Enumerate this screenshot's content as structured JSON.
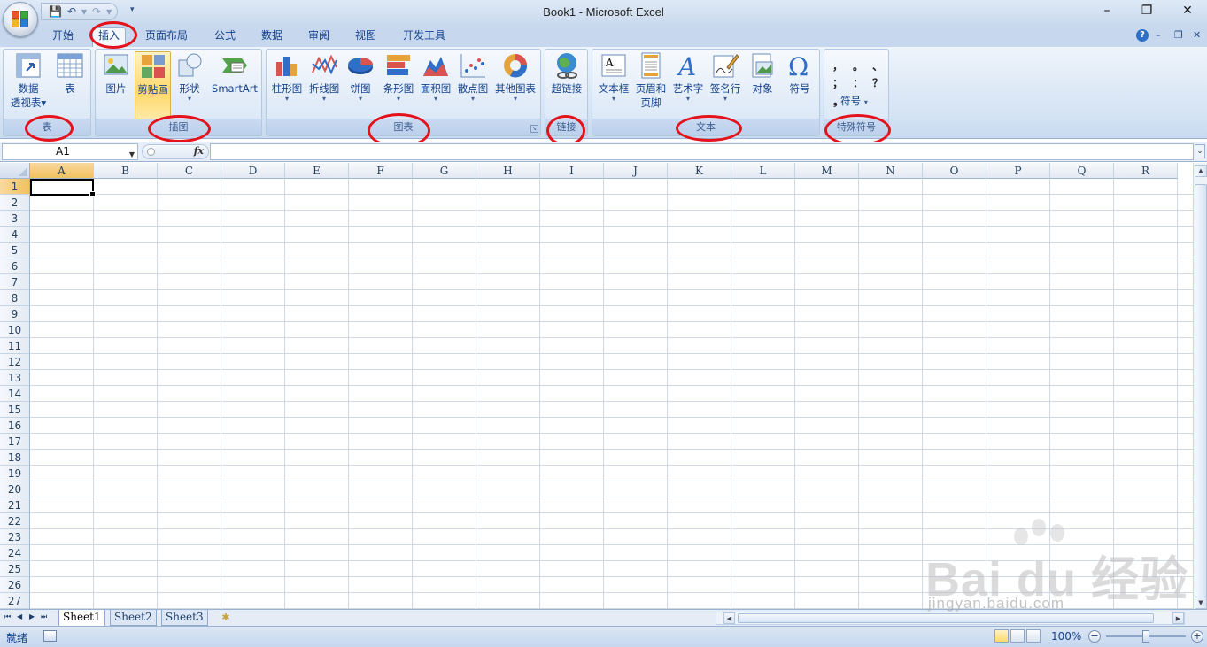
{
  "window": {
    "title": "Book1 - Microsoft Excel",
    "minimize": "–",
    "restore": "❐",
    "close": "✕"
  },
  "qat": {
    "save": "💾",
    "undo": "↶",
    "undo_dd": "▾",
    "redo": "↷",
    "redo_dd": "▾",
    "customize": "₹"
  },
  "tabs": [
    "开始",
    "插入",
    "页面布局",
    "公式",
    "数据",
    "审阅",
    "视图",
    "开发工具"
  ],
  "active_tab": "插入",
  "tab_right": {
    "help": "?",
    "min": "–",
    "restore": "❐",
    "close": "✕"
  },
  "groups": {
    "table": {
      "label": "表",
      "buttons": [
        {
          "label": "数据",
          "label2": "透视表",
          "dd": "▾"
        },
        {
          "label": "表"
        }
      ]
    },
    "illustrations": {
      "label": "插图",
      "buttons": [
        {
          "label": "图片"
        },
        {
          "label": "剪贴画"
        },
        {
          "label": "形状",
          "dd": "▾"
        },
        {
          "label": "SmartArt"
        }
      ]
    },
    "charts": {
      "label": "图表",
      "buttons": [
        {
          "label": "柱形图"
        },
        {
          "label": "折线图"
        },
        {
          "label": "饼图"
        },
        {
          "label": "条形图"
        },
        {
          "label": "面积图"
        },
        {
          "label": "散点图"
        },
        {
          "label": "其他图表"
        }
      ],
      "dd": "▾"
    },
    "links": {
      "label": "链接",
      "buttons": [
        {
          "label": "超链接"
        }
      ]
    },
    "text": {
      "label": "文本",
      "buttons": [
        {
          "label": "文本框",
          "dd": "▾"
        },
        {
          "label": "页眉和",
          "label2": "页脚"
        },
        {
          "label": "艺术字",
          "dd": "▾"
        },
        {
          "label": "签名行",
          "dd": "▾"
        },
        {
          "label": "对象"
        },
        {
          "label": "符号"
        }
      ]
    },
    "special": {
      "label": "特殊符号",
      "marks_row1": [
        "，",
        "。",
        "、"
      ],
      "marks_row2": [
        "；",
        "：",
        "？"
      ],
      "symbol_label": "符号",
      "dd": "▾"
    }
  },
  "launcher": "↘",
  "formula_bar": {
    "name_box": "A1",
    "name_box_arrow": "▼",
    "fx": "fx",
    "value": "",
    "expand": "⌄"
  },
  "columns": [
    "A",
    "B",
    "C",
    "D",
    "E",
    "F",
    "G",
    "H",
    "I",
    "J",
    "K",
    "L",
    "M",
    "N",
    "O",
    "P",
    "Q",
    "R"
  ],
  "rows": [
    "1",
    "2",
    "3",
    "4",
    "5",
    "6",
    "7",
    "8",
    "9",
    "10",
    "11",
    "12",
    "13",
    "14",
    "15",
    "16",
    "17",
    "18",
    "19",
    "20",
    "21",
    "22",
    "23",
    "24",
    "25",
    "26",
    "27"
  ],
  "sheets": [
    "Sheet1",
    "Sheet2",
    "Sheet3"
  ],
  "sheet_nav": [
    "⏮",
    "◀",
    "▶",
    "⏭"
  ],
  "status": {
    "text": "就绪",
    "zoom": "100%",
    "zoom_minus": "−",
    "zoom_plus": "+"
  },
  "scroll": {
    "up": "▲",
    "down": "▼",
    "left": "◀",
    "right": "▶"
  },
  "watermark": {
    "brand": "Bai du 经验",
    "url": "jingyan.baidu.com"
  },
  "colors": {
    "ribbon": "#dbe7f5",
    "accent_selected": "#ffd86b",
    "annotation": "#e3121b",
    "header_selected": "#f1c15f"
  }
}
